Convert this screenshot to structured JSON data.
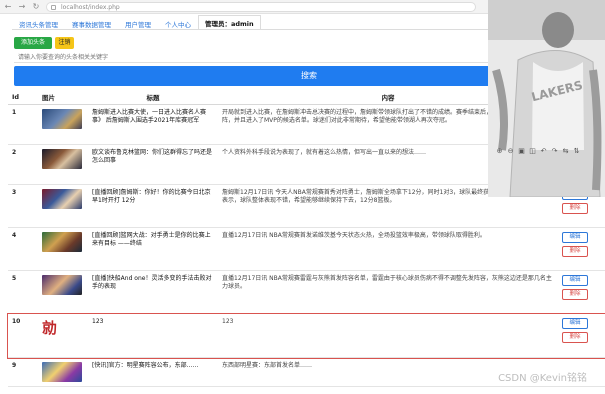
{
  "browser": {
    "back_icon": "arrow-left",
    "forward_icon": "arrow-right",
    "refresh_icon": "refresh",
    "address": "localhost/index.php"
  },
  "tabs": [
    {
      "label": "资讯头条管理"
    },
    {
      "label": "赛事数据管理"
    },
    {
      "label": "用户管理"
    },
    {
      "label": "个人中心"
    },
    {
      "label": "管理员：admin"
    }
  ],
  "actions": {
    "add_label": "添加头条",
    "logout_label": "注销"
  },
  "search": {
    "placeholder": "请输入你要查询的头条相关关键字",
    "button_label": "搜索"
  },
  "table": {
    "headers": {
      "id": "Id",
      "image": "图片",
      "title": "标题",
      "content": "内容"
    },
    "rows": [
      {
        "id": "1",
        "title": "詹姆斯进入比赛大使，一日进入比赛名人赛事》 后詹姆斯入围选手2021年库赛冠军",
        "content": "开局就到进入比赛，在詹姆斯冲击总决赛的过程中，詹姆斯带领球队打出了不错的成绩。赛季结束后，詹姆斯入选最佳阵容一阵，并且进入了MVP的候选名单。球迷们对此非常期待，希望他能带领湖人再次夺冠。"
      },
      {
        "id": "2",
        "title": "欧文谈布鲁克林篮网：你们这群得忘了吗还是怎么回事",
        "content": "个人资料外科手段说为表现了，就有着这么热情，但写出一直以来的想法……"
      },
      {
        "id": "3",
        "title": "[直播回顾]詹姆斯：你好！你的比赛今日北京早1时开打 12分",
        "content": "詹姆斯12月17日讯 今天人NBA常规赛首秀对阵勇士，詹姆斯全场拿下12分，同时1对3，球队最终获得了胜利。赛后詹姆斯表示，球队整体表现不错，希望能够继续保持下去，12分8篮板。"
      },
      {
        "id": "4",
        "title": "[直播回顾]篮网大战：对手勇士是你的比赛上来有目标 ——终结",
        "content": "直播12月17日讯 NBA常规赛首发诺维茨基今天状态火热，全场投篮效率极高，带领球队取得胜利。"
      },
      {
        "id": "5",
        "title": "[直播]快船And one！灵活多变的手法击败对手的表现",
        "content": "直播12月17日讯 NBA常规赛雷霆与灰熊首发阵容名单，雷霆由于核心球员伤病不得不调整先发阵容，灰熊这边还是那几名主力球员。"
      },
      {
        "id": "10",
        "title": "123",
        "content": "123"
      },
      {
        "id": "9",
        "title": "[快讯]官方：明星赛阵容公布，东部……",
        "content": "东西部明星赛：东部首发名单……"
      }
    ],
    "edit_label": "编辑",
    "delete_label": "删除",
    "seal_text": "勍"
  },
  "viewer": {
    "jersey_text": "LAKERS",
    "toolbar_icons": [
      "zoom-in-icon",
      "zoom-out-icon",
      "fit-icon",
      "reset-icon",
      "rotate-left-icon",
      "rotate-right-icon",
      "flip-icon",
      "flip-vertical-icon"
    ]
  },
  "watermark": "CSDN @Kevin铭铭"
}
